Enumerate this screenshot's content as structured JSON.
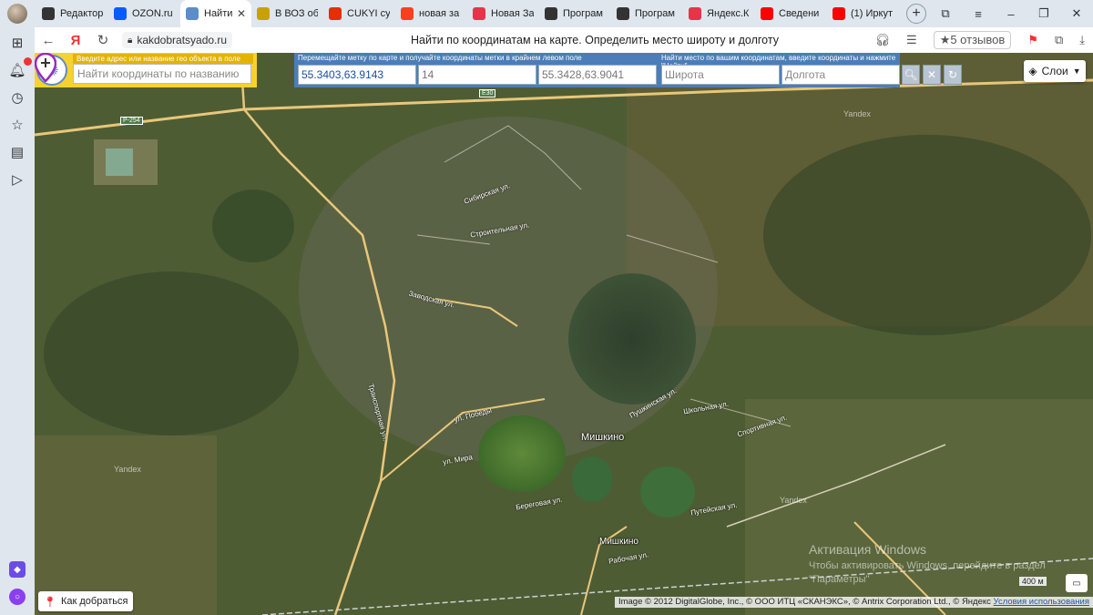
{
  "tabs": [
    {
      "label": "Редактор",
      "icon": "plus-square-icon",
      "color": "#333333"
    },
    {
      "label": "OZON.ru",
      "icon": "ozon-icon",
      "color": "#0a5bff"
    },
    {
      "label": "Найти",
      "icon": "kakdobratsyado-icon",
      "color": "#5b8dc9",
      "active": true
    },
    {
      "label": "В ВОЗ об",
      "icon": "stripes-icon",
      "color": "#c8a200"
    },
    {
      "label": "CUKYI су",
      "icon": "aliexpress-icon",
      "color": "#e62e04"
    },
    {
      "label": "новая за",
      "icon": "yandex-y-icon",
      "color": "#fc3f1d"
    },
    {
      "label": "Новая За",
      "icon": "media-icon",
      "color": "#e8334a"
    },
    {
      "label": "Програм",
      "icon": "screen-icon",
      "color": "#333333"
    },
    {
      "label": "Програм",
      "icon": "screen-icon",
      "color": "#333333"
    },
    {
      "label": "Яндекс.К",
      "icon": "yandex-market-icon",
      "color": "#e8334a"
    },
    {
      "label": "Сведени",
      "icon": "youtube-icon",
      "color": "#ff0000"
    },
    {
      "label": "(1) Иркут",
      "icon": "youtube-icon",
      "color": "#ff0000"
    }
  ],
  "tab_close": "✕",
  "newtab": "+",
  "address": {
    "domain": "kakdobratsyado.ru",
    "title": "Найти по координатам на карте. Определить место широту и долготу",
    "reviews": "★5 отзывов"
  },
  "panel": {
    "name_hint": "Введите адрес или название гео объекта в поле",
    "name_placeholder": "Найти координаты по названию",
    "marker_hint": "Перемещайте метку по карте и получайте координаты метки в крайнем левом поле",
    "coord_hint": "Найти место по вашим координатам, введите координаты и нажмите \"Найти\"",
    "marker_coords": "55.3403,63.9143",
    "zoom": "14",
    "center_coords": "55.3428,63.9041",
    "lat_placeholder": "Широта",
    "lon_placeholder": "Долгота"
  },
  "layers_label": "Слои",
  "map_labels": {
    "town1": "Мишкино",
    "town2": "Мишкино",
    "road_e30": "E30",
    "road_r254": "Р-254",
    "yandex1": "Yandex",
    "yandex2": "Yandex",
    "yandex3": "Yandex",
    "streets": [
      "Сибирская ул.",
      "Строительная ул.",
      "Заводская ул.",
      "ул. Победы",
      "ул. Мира",
      "Береговая ул.",
      "Путейская ул.",
      "Рабочая ул.",
      "Спортивная ул.",
      "Транспортная ул.",
      "Пушкинская ул.",
      "Школьная ул."
    ]
  },
  "windows_activation": {
    "line1": "Активация Windows",
    "line2": "Чтобы активировать Windows, перейдите в раздел",
    "line3": "\"Параметры\""
  },
  "route_button": "Как добраться",
  "scale": "400 м",
  "attribution": "Image © 2012 DigitalGlobe, Inc., © ООО ИТЦ «СКАНЭКС», © Antrix Corporation Ltd., © Яндекс",
  "terms": "Условия использования",
  "colors": {
    "yellow_panel": "#f6d22e",
    "blue_panel": "#4b7eb8",
    "marker": "#9b27c4",
    "road": "#e8c77a"
  }
}
